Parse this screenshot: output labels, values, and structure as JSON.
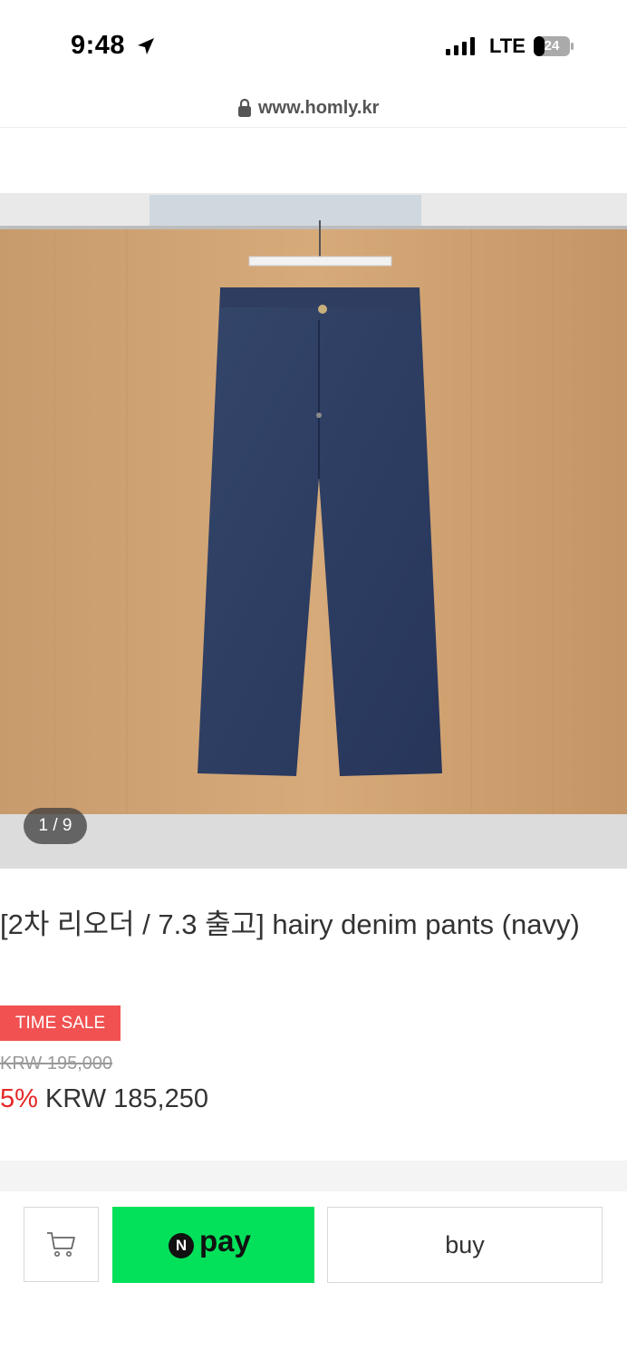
{
  "status_bar": {
    "time": "9:48",
    "network": "LTE",
    "battery": "24"
  },
  "browser": {
    "url": "www.homly.kr"
  },
  "product": {
    "image_counter": "1 / 9",
    "title": "[2차 리오더 / 7.3 출고] hairy denim pants (navy)",
    "badge": "TIME SALE",
    "original_price": "KRW 195,000",
    "discount": "5%",
    "sale_price": "KRW 185,250"
  },
  "actions": {
    "cart_icon": "cart-icon",
    "npay_logo_letter": "N",
    "npay_label": "pay",
    "buy_label": "buy"
  },
  "colors": {
    "sale_badge": "#f15151",
    "discount_text": "#e52727",
    "npay_green": "#03e15a"
  }
}
